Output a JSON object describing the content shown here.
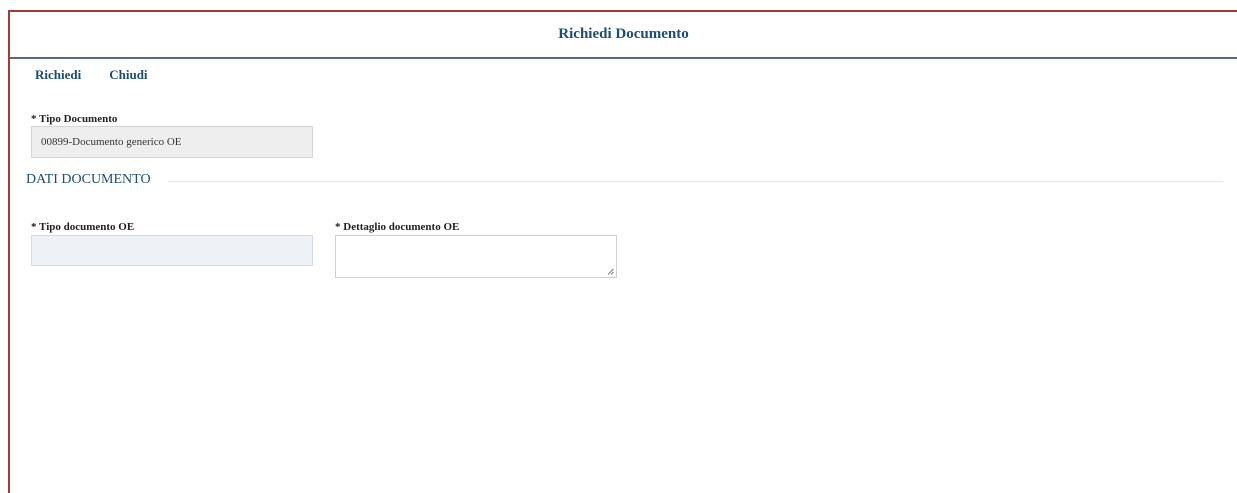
{
  "header": {
    "title": "Richiedi Documento"
  },
  "toolbar": {
    "richiedi_label": "Richiedi",
    "chiudi_label": "Chiudi"
  },
  "tipo_documento": {
    "label": "* Tipo Documento",
    "value": "00899-Documento generico OE"
  },
  "section": {
    "title": "DATI DOCUMENTO"
  },
  "tipo_documento_oe": {
    "label": "* Tipo documento OE",
    "value": ""
  },
  "dettaglio_documento_oe": {
    "label": "* Dettaglio documento OE",
    "value": ""
  },
  "colors": {
    "frame_border": "#a33a3a",
    "title_text": "#1d4d70",
    "readonly_bg": "#eeeeee",
    "select_bg": "#eef2f7"
  }
}
